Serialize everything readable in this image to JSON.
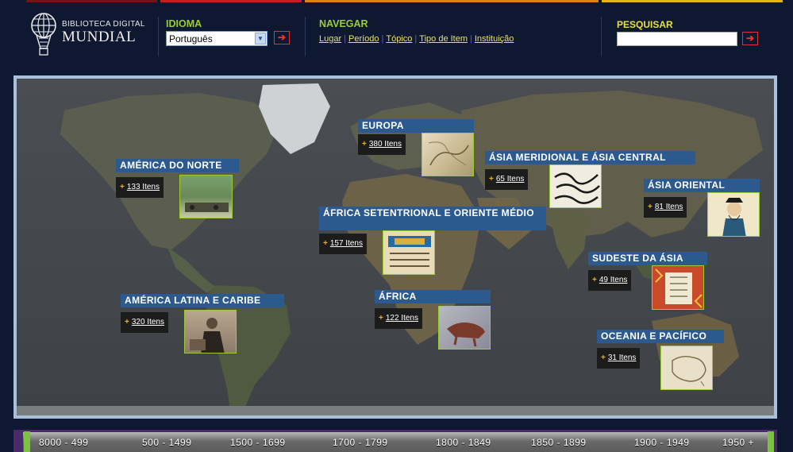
{
  "header": {
    "logo_line1": "BIBLIOTECA DIGITAL",
    "logo_line2": "MUNDIAL",
    "idioma_label": "IDIOMA",
    "language_selected": "Português",
    "navegar_label": "NAVEGAR",
    "nav_links": [
      "Lugar",
      "Período",
      "Tópico",
      "Tipo de Item",
      "Instituição"
    ],
    "pesquisar_label": "PESQUISAR",
    "go_symbol": "➔",
    "dropdown_symbol": "▼"
  },
  "regions": [
    {
      "title": "EUROPA",
      "count": "380 Itens"
    },
    {
      "title": "AMÉRICA DO NORTE",
      "count": "133 Itens"
    },
    {
      "title": "ÁSIA MERIDIONAL E ÁSIA CENTRAL",
      "count": "65 Itens"
    },
    {
      "title": "ÁSIA ORIENTAL",
      "count": "81 Itens"
    },
    {
      "title": "ÁFRICA SETENTRIONAL E ORIENTE MÉDIO",
      "count": "157 Itens"
    },
    {
      "title": "SUDESTE DA ÁSIA",
      "count": "49 Itens"
    },
    {
      "title": "AMÉRICA LATINA E CARIBE",
      "count": "320 Itens"
    },
    {
      "title": "ÁFRICA",
      "count": "122 Itens"
    },
    {
      "title": "OCEANIA E PACÍFICO",
      "count": "31 Itens"
    }
  ],
  "count_plus": "+",
  "timeline": {
    "periods": [
      "8000 - 499",
      "500 - 1499",
      "1500 - 1699",
      "1700 - 1799",
      "1800 - 1849",
      "1850 - 1899",
      "1900 - 1949",
      "1950 +"
    ]
  },
  "colors": {
    "label_green": "#9acd32",
    "nav_green": "#9acd32",
    "pesquisar_yellow": "#e8e040",
    "region_blue": "#2c5a8e"
  }
}
